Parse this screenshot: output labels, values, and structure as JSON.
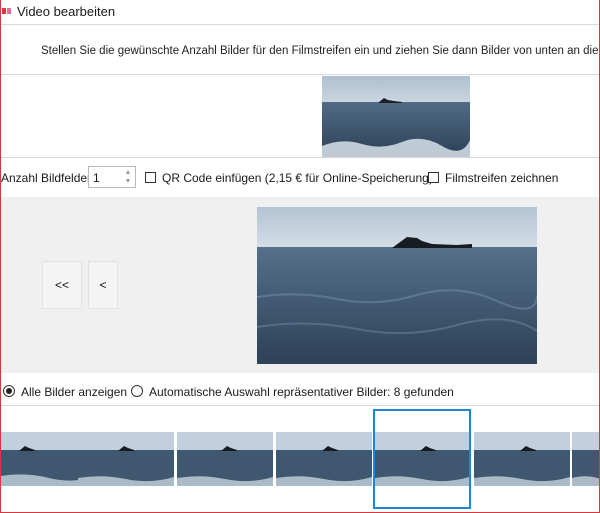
{
  "window": {
    "title": "Video bearbeiten",
    "logo_icon": "app-logo-icon",
    "accent_color": "#d9363e"
  },
  "instruction": "Stellen Sie die gewünschte Anzahl Bilder für den Filmstreifen ein und ziehen Sie dann Bilder von unten an die gew",
  "options": {
    "frame_count_label": "Anzahl Bildfelder",
    "frame_count_value": "1",
    "qr_code": {
      "label": "QR Code einfügen (2,15 € für Online-Speicherung)",
      "checked": false
    },
    "draw_filmstrip": {
      "label": "Filmstreifen zeichnen",
      "checked": false
    }
  },
  "navigation": {
    "first_label": "<<",
    "prev_label": "<"
  },
  "selection_mode": {
    "all_label": "Alle Bilder anzeigen",
    "auto_label": "Automatische Auswahl repräsentativer Bilder: 8 gefunden",
    "selected": "all"
  },
  "thumbnails": {
    "selected_index": 4,
    "selection_color": "#1f86d6",
    "count_visible": 7
  }
}
